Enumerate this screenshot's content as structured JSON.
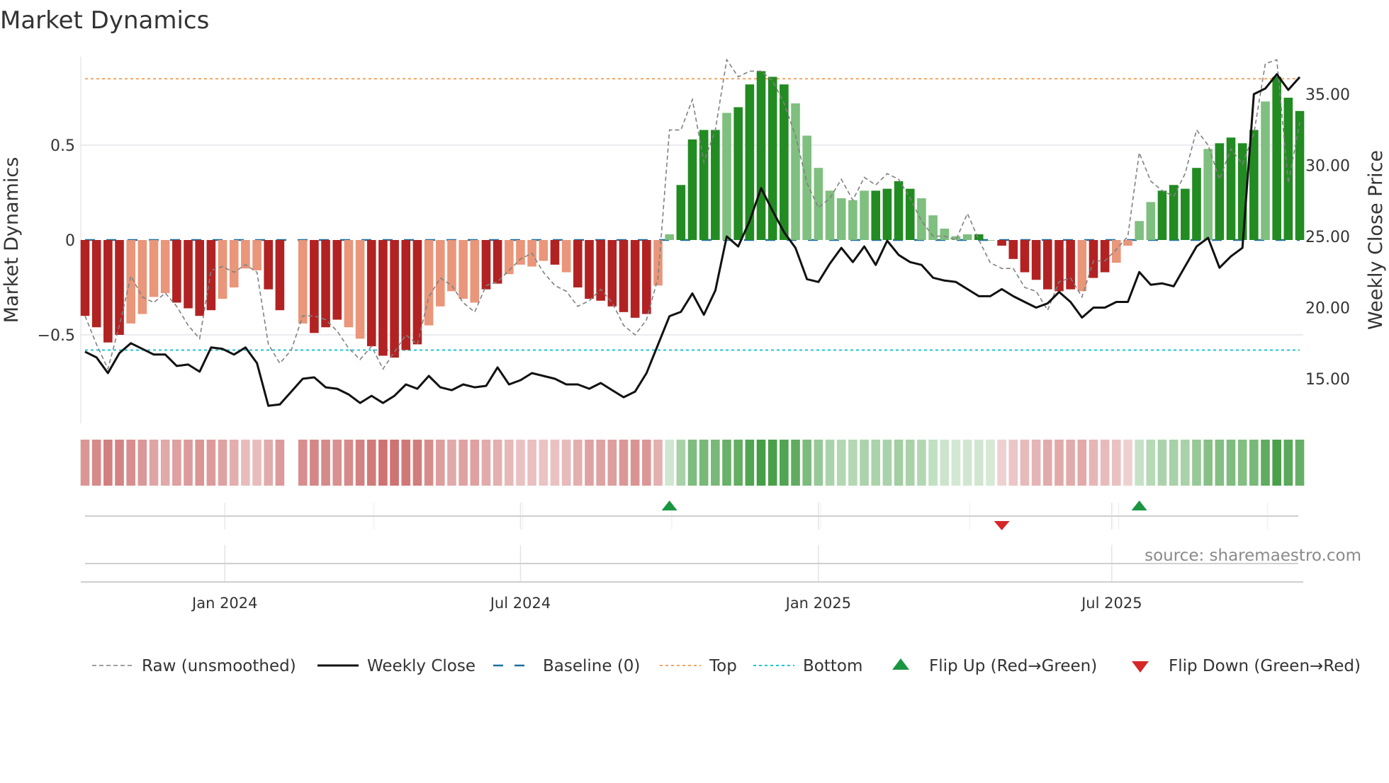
{
  "chart_data": {
    "type": "bar",
    "title": "Market Dynamics",
    "ylabel": "Market Dynamics",
    "y2label": "Weekly Close Price",
    "ylim": [
      -0.78,
      1.0
    ],
    "y2lim": [
      11.2,
      38.5
    ],
    "yticks": [
      {
        "v": 0.5,
        "label": "0.5"
      },
      {
        "v": 0,
        "label": "0"
      },
      {
        "v": -0.5,
        "label": "−0.5"
      }
    ],
    "y2ticks": [
      {
        "v": 35,
        "label": "35.00"
      },
      {
        "v": 30,
        "label": "30.00"
      },
      {
        "v": 25,
        "label": "25.00"
      },
      {
        "v": 20,
        "label": "20.00"
      },
      {
        "v": 15,
        "label": "15.00"
      }
    ],
    "xticks": [
      {
        "week": 13.2,
        "label": "Jan 2024"
      },
      {
        "week": 39,
        "label": "Jul 2024"
      },
      {
        "week": 65,
        "label": "Jan 2025"
      },
      {
        "week": 90.6,
        "label": "Jul 2025"
      }
    ],
    "top_level": 0.85,
    "bottom_level": -0.58,
    "baseline": 0,
    "dynamics": [
      -0.4,
      -0.46,
      -0.54,
      -0.5,
      -0.44,
      -0.39,
      -0.3,
      -0.28,
      -0.33,
      -0.36,
      -0.4,
      -0.37,
      -0.31,
      -0.25,
      -0.15,
      -0.16,
      -0.26,
      -0.37,
      null,
      -0.44,
      -0.49,
      -0.46,
      -0.42,
      -0.46,
      -0.52,
      -0.56,
      -0.61,
      -0.62,
      -0.58,
      -0.55,
      -0.45,
      -0.35,
      -0.27,
      -0.31,
      -0.33,
      -0.26,
      -0.23,
      -0.18,
      -0.13,
      -0.14,
      -0.11,
      -0.13,
      -0.17,
      -0.25,
      -0.31,
      -0.32,
      -0.35,
      -0.38,
      -0.41,
      -0.39,
      -0.24,
      0.03,
      0.29,
      0.53,
      0.58,
      0.58,
      0.67,
      0.7,
      0.82,
      0.89,
      0.86,
      0.82,
      0.72,
      0.55,
      0.38,
      0.26,
      0.22,
      0.21,
      0.26,
      0.26,
      0.27,
      0.31,
      0.27,
      0.22,
      0.13,
      0.06,
      0.02,
      0.03,
      0.03,
      0.0,
      -0.03,
      -0.1,
      -0.17,
      -0.21,
      -0.26,
      -0.27,
      -0.26,
      -0.27,
      -0.2,
      -0.17,
      -0.12,
      -0.03,
      0.1,
      0.2,
      0.26,
      0.29,
      0.27,
      0.38,
      0.48,
      0.51,
      0.54,
      0.51,
      0.58,
      0.73,
      0.86,
      0.75,
      0.68
    ],
    "strength": "sssswwwwsssswwwwsss-ssswwssssswwwwwsswwwwswssssssswwsssswssssswwwwwwwsssswwwwwssssssssswsswwwwsssswsssswsssww",
    "raw": [
      -0.4,
      -0.55,
      -0.68,
      -0.45,
      -0.19,
      -0.3,
      -0.33,
      -0.28,
      -0.35,
      -0.45,
      -0.52,
      -0.16,
      -0.14,
      -0.17,
      -0.13,
      -0.17,
      -0.55,
      -0.65,
      -0.58,
      -0.4,
      -0.4,
      -0.42,
      -0.48,
      -0.57,
      -0.63,
      -0.56,
      -0.68,
      -0.59,
      -0.5,
      -0.55,
      -0.3,
      -0.2,
      -0.24,
      -0.33,
      -0.38,
      -0.24,
      -0.22,
      -0.16,
      -0.1,
      -0.07,
      -0.17,
      -0.24,
      -0.27,
      -0.35,
      -0.32,
      -0.26,
      -0.33,
      -0.45,
      -0.5,
      -0.42,
      -0.2,
      0.58,
      0.58,
      0.74,
      0.41,
      0.58,
      0.95,
      0.86,
      0.89,
      0.89,
      0.84,
      0.72,
      0.55,
      0.3,
      0.17,
      0.22,
      0.32,
      0.21,
      0.33,
      0.29,
      0.35,
      0.32,
      0.22,
      0.1,
      0.02,
      0.02,
      0.0,
      0.14,
      0.0,
      -0.12,
      -0.15,
      -0.15,
      -0.25,
      -0.27,
      -0.37,
      -0.22,
      -0.2,
      -0.3,
      -0.11,
      -0.11,
      -0.05,
      0.02,
      0.46,
      0.31,
      0.26,
      0.23,
      0.35,
      0.58,
      0.5,
      0.32,
      0.48,
      0.4,
      0.56,
      0.93,
      0.95,
      0.3,
      0.62
    ],
    "weekly_close": [
      16.9,
      16.5,
      15.4,
      16.8,
      17.5,
      17.1,
      16.7,
      16.7,
      15.9,
      16.0,
      15.5,
      17.2,
      17.1,
      16.7,
      17.2,
      16.1,
      13.1,
      13.2,
      14.1,
      15.0,
      15.1,
      14.4,
      14.3,
      13.9,
      13.3,
      13.8,
      13.3,
      13.8,
      14.6,
      14.3,
      15.2,
      14.4,
      14.2,
      14.6,
      14.4,
      14.5,
      15.8,
      14.6,
      14.9,
      15.4,
      15.2,
      15.0,
      14.6,
      14.6,
      14.3,
      14.7,
      14.2,
      13.7,
      14.1,
      15.4,
      17.4,
      19.4,
      19.7,
      21.0,
      19.5,
      21.2,
      25.0,
      24.3,
      26.1,
      28.4,
      26.8,
      25.3,
      24.2,
      22.0,
      21.8,
      23.1,
      24.2,
      23.2,
      24.3,
      23.0,
      24.7,
      23.7,
      23.2,
      23.0,
      22.1,
      21.9,
      21.8,
      21.3,
      20.8,
      20.8,
      21.3,
      20.8,
      20.4,
      20.0,
      20.3,
      21.1,
      20.4,
      19.3,
      20.0,
      20.0,
      20.4,
      20.4,
      22.5,
      21.6,
      21.7,
      21.5,
      22.9,
      24.3,
      24.9,
      22.8,
      23.6,
      24.2,
      35.0,
      35.4,
      36.4,
      35.3,
      36.2
    ],
    "flips": [
      {
        "week": 52,
        "dir": "up"
      },
      {
        "week": 81,
        "dir": "down"
      },
      {
        "week": 93,
        "dir": "up"
      }
    ],
    "legend": {
      "placement": "bottom",
      "items": [
        {
          "label": "Raw (unsmoothed)",
          "kind": "raw"
        },
        {
          "label": "Weekly Close",
          "kind": "close"
        },
        {
          "label": "Baseline (0)",
          "kind": "baseline"
        },
        {
          "label": "Top",
          "kind": "top"
        },
        {
          "label": "Bottom",
          "kind": "bottom"
        },
        {
          "label": "Flip Up (Red→Green)",
          "kind": "flipup"
        },
        {
          "label": "Flip Down (Green→Red)",
          "kind": "flipdown"
        }
      ]
    },
    "source": "source: sharemaestro.com",
    "colors": {
      "neg_strong": "#b22222",
      "neg_weak": "#e9967a",
      "pos_strong": "#228b22",
      "pos_weak": "#7fbf7f",
      "raw": "#808080",
      "close": "#111111",
      "baseline": "#1f6f9f",
      "top": "#f4a460",
      "bottom": "#1fc3d3",
      "flip_up": "#1a9641",
      "flip_down": "#d62728"
    }
  }
}
